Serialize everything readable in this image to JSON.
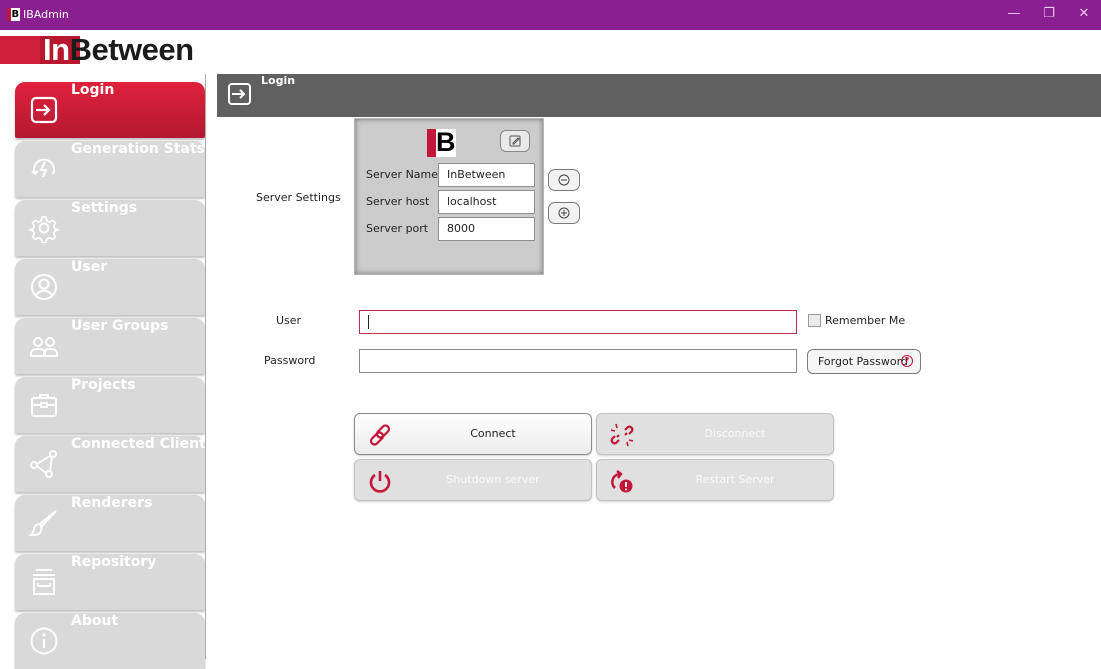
{
  "window": {
    "title": "IBAdmin",
    "app_icon_text": "IB",
    "controls": {
      "minimize": "—",
      "maximize": "❐",
      "close": "✕"
    }
  },
  "brand": {
    "logo_in": "In",
    "logo_between": "Between"
  },
  "sidebar": {
    "items": [
      {
        "label": "Login",
        "icon": "login-icon",
        "active": true
      },
      {
        "label": "Generation Stats",
        "icon": "generation-stats-icon",
        "active": false
      },
      {
        "label": "Settings",
        "icon": "gear-icon",
        "active": false
      },
      {
        "label": "User",
        "icon": "user-icon",
        "active": false
      },
      {
        "label": "User Groups",
        "icon": "user-groups-icon",
        "active": false
      },
      {
        "label": "Projects",
        "icon": "briefcase-icon",
        "active": false
      },
      {
        "label": "Connected Clients",
        "icon": "connected-clients-icon",
        "active": false
      },
      {
        "label": "Renderers",
        "icon": "brush-icon",
        "active": false
      },
      {
        "label": "Repository",
        "icon": "archive-icon",
        "active": false
      },
      {
        "label": "About",
        "icon": "info-icon",
        "active": false
      }
    ]
  },
  "header": {
    "title": "Login",
    "icon": "login-icon"
  },
  "server_settings": {
    "section_label": "Server Settings",
    "logo_text": "B",
    "fields": [
      {
        "label": "Server Name",
        "value": "InBetween"
      },
      {
        "label": "Server host",
        "value": "localhost"
      },
      {
        "label": "Server port",
        "value": "8000"
      }
    ]
  },
  "login_form": {
    "user_label": "User",
    "user_value": "",
    "password_label": "Password",
    "password_value": "",
    "remember_me_label": "Remember Me",
    "remember_me_checked": false,
    "forgot_password_label": "Forgot Password",
    "forgot_password_icon": "?"
  },
  "actions": {
    "connect": {
      "label": "Connect",
      "enabled": true,
      "icon": "link-icon"
    },
    "disconnect": {
      "label": "Disconnect",
      "enabled": false,
      "icon": "broken-link-icon"
    },
    "shutdown": {
      "label": "Shutdown server",
      "enabled": false,
      "icon": "power-icon"
    },
    "restart": {
      "label": "Restart Server",
      "enabled": false,
      "icon": "restart-warning-icon"
    }
  },
  "colors": {
    "titlebar": "#8a1f92",
    "accent_red": "#c3163a",
    "nav_active": "#d01c36",
    "nav_inactive": "#d9d9d9",
    "header_bg": "#606060"
  }
}
